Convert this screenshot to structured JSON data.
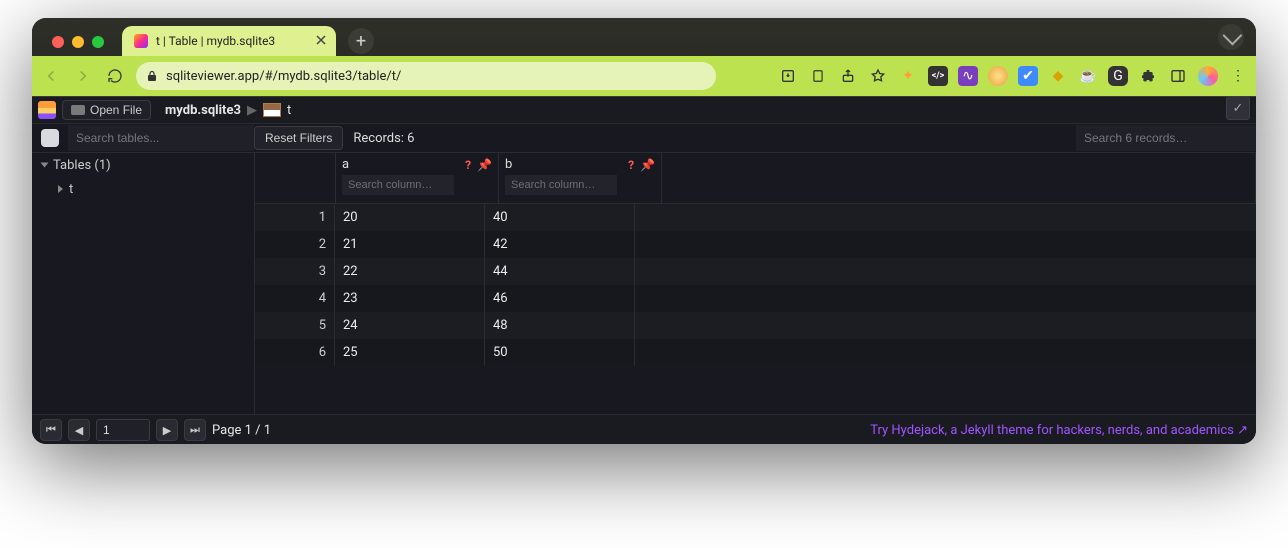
{
  "browser": {
    "tab_title": "t | Table | mydb.sqlite3",
    "url": "sqliteviewer.app/#/mydb.sqlite3/table/t/"
  },
  "app": {
    "open_file_label": "Open File",
    "breadcrumb_db": "mydb.sqlite3",
    "breadcrumb_table": "t",
    "search_tables_placeholder": "Search tables...",
    "reset_filters_label": "Reset Filters",
    "records_label": "Records: 6",
    "records_search_placeholder": "Search 6 records…"
  },
  "sidebar": {
    "heading": "Tables (1)",
    "items": [
      {
        "label": "t"
      }
    ]
  },
  "columns": [
    {
      "name": "a",
      "search_placeholder": "Search column…"
    },
    {
      "name": "b",
      "search_placeholder": "Search column…"
    }
  ],
  "rows": [
    {
      "n": "1",
      "a": "20",
      "b": "40"
    },
    {
      "n": "2",
      "a": "21",
      "b": "42"
    },
    {
      "n": "3",
      "a": "22",
      "b": "44"
    },
    {
      "n": "4",
      "a": "23",
      "b": "46"
    },
    {
      "n": "5",
      "a": "24",
      "b": "48"
    },
    {
      "n": "6",
      "a": "25",
      "b": "50"
    }
  ],
  "footer": {
    "page_input": "1",
    "page_label": "Page 1 / 1",
    "promo": "Try Hydejack, a Jekyll theme for hackers, nerds, and academics ↗"
  }
}
